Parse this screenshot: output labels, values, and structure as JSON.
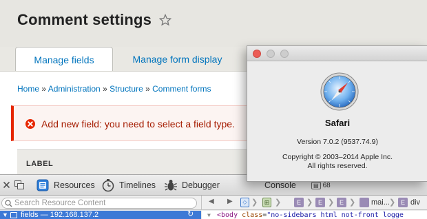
{
  "page": {
    "title": "Comment settings",
    "tabs": [
      "Manage fields",
      "Manage form display"
    ],
    "breadcrumb": [
      "Home",
      "Administration",
      "Structure",
      "Comment forms"
    ],
    "error": "Add new field: you need to select a field type.",
    "table_header": "LABEL"
  },
  "inspector": {
    "toolbar": [
      "Resources",
      "Timelines",
      "Debugger",
      "Console"
    ],
    "console_count": "68",
    "search_placeholder": "Search Resource Content",
    "resource_item": "fields — 192.168.137.2",
    "crumb_labels": [
      "E",
      "E",
      "E",
      "mai...",
      "E",
      "div"
    ],
    "dom_line": {
      "tag_open": "<body ",
      "attr": "class",
      "eq": "=",
      "value": "\"no-sidebars html not-front logge"
    }
  },
  "about": {
    "app_name": "Safari",
    "version": "Version 7.0.2 (9537.74.9)",
    "copyright": "Copyright © 2003–2014 Apple Inc.",
    "rights": "All rights reserved."
  },
  "colors": {
    "link": "#0074bd",
    "error": "#e62600",
    "selection": "#3d79d6"
  }
}
